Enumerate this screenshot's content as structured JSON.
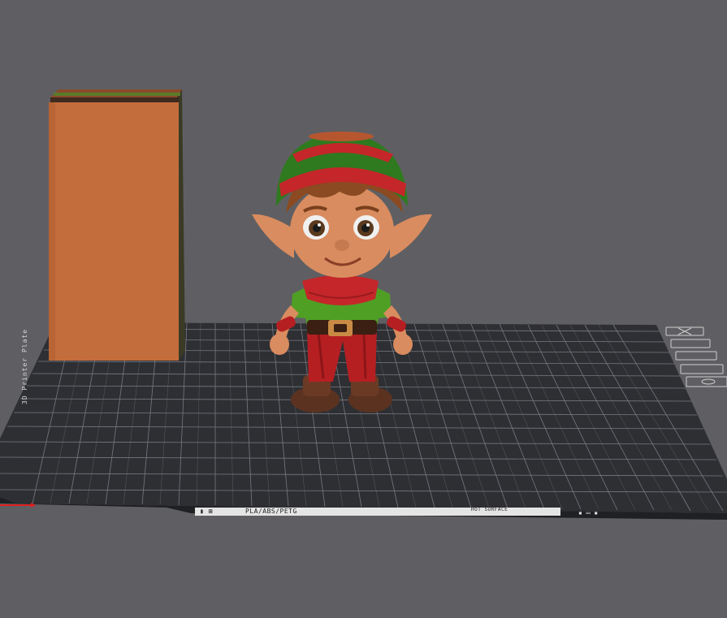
{
  "bed": {
    "label_icons": "▮ ⊞",
    "material": "PLA/ABS/PETG",
    "surface": "HOT SURFACE",
    "side_text": "3D Printer Plate",
    "end_marks": "▪ ▭ ▪"
  },
  "toolbar": {
    "icons": [
      "close-icon",
      "checklist-icon",
      "list-icon",
      "lock-icon",
      "eye-icon"
    ]
  },
  "colors": {
    "background": "#5f5f63",
    "bed": "#2e2f33",
    "grid": "#8d8e93",
    "tower": "#c46d3c",
    "hat_green": "#2f7a1f",
    "hat_red": "#c4262a",
    "skin": "#d98c5f",
    "shirt": "#4f9f25",
    "pants": "#b51f22",
    "boots": "#5b3220"
  }
}
